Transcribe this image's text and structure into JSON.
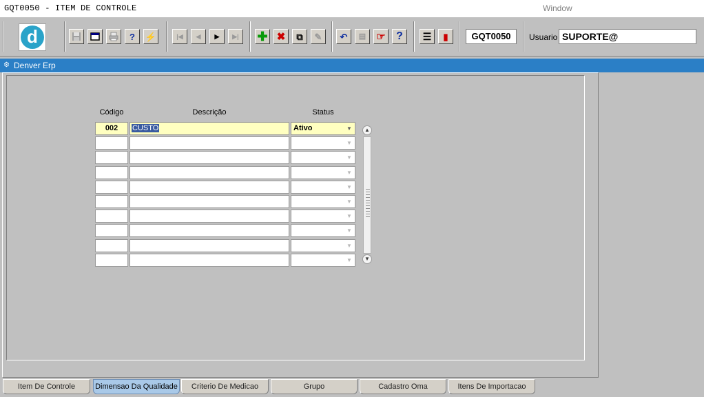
{
  "app": {
    "title": "GQT0050 - ITEM DE CONTROLE",
    "window_menu": "Window"
  },
  "toolbar": {
    "logo_letter": "d",
    "buttons": [
      {
        "icon": "save-icon"
      },
      {
        "icon": "window-icon"
      },
      {
        "icon": "print-icon"
      },
      {
        "icon": "query-icon"
      },
      {
        "icon": "execute-query-icon"
      },
      {
        "icon": "first-record-icon",
        "glyph": "|◀"
      },
      {
        "icon": "previous-record-icon",
        "glyph": "◀"
      },
      {
        "icon": "next-record-icon",
        "glyph": "▶"
      },
      {
        "icon": "last-record-icon",
        "glyph": "▶|"
      },
      {
        "icon": "insert-record-icon",
        "glyph": "✚"
      },
      {
        "icon": "delete-record-icon",
        "glyph": "✖"
      },
      {
        "icon": "duplicate-record-icon",
        "glyph": "⧉"
      },
      {
        "icon": "edit-icon",
        "glyph": "✎"
      },
      {
        "icon": "undo-icon",
        "glyph": "↶"
      },
      {
        "icon": "clipboard-icon",
        "glyph": "📋"
      },
      {
        "icon": "pointer-help-icon",
        "glyph": "☞"
      },
      {
        "icon": "help-icon",
        "glyph": "?"
      },
      {
        "icon": "menu-icon",
        "glyph": "☰"
      },
      {
        "icon": "exit-icon",
        "glyph": "⎋"
      }
    ],
    "form_code": "GQT0050",
    "user_label": "Usuario",
    "user_value": "SUPORTE@"
  },
  "window": {
    "title": "Denver Erp"
  },
  "grid": {
    "headers": {
      "code": "Código",
      "description": "Descrição",
      "status": "Status"
    },
    "rows": [
      {
        "code": "002",
        "description": "CUSTO",
        "status": "Ativo"
      },
      {
        "code": "",
        "description": "",
        "status": ""
      },
      {
        "code": "",
        "description": "",
        "status": ""
      },
      {
        "code": "",
        "description": "",
        "status": ""
      },
      {
        "code": "",
        "description": "",
        "status": ""
      },
      {
        "code": "",
        "description": "",
        "status": ""
      },
      {
        "code": "",
        "description": "",
        "status": ""
      },
      {
        "code": "",
        "description": "",
        "status": ""
      },
      {
        "code": "",
        "description": "",
        "status": ""
      },
      {
        "code": "",
        "description": "",
        "status": ""
      }
    ]
  },
  "tabs": [
    {
      "label": "Item De Controle",
      "active": false
    },
    {
      "label": "Dimensao Da Qualidade",
      "active": true
    },
    {
      "label": "Criterio De Medicao",
      "active": false
    },
    {
      "label": "Grupo",
      "active": false
    },
    {
      "label": "Cadastro Oma",
      "active": false
    },
    {
      "label": "Itens De Importacao",
      "active": false
    }
  ],
  "colors": {
    "window_bar": "#2b7fc6",
    "active_cell": "#ffffc0",
    "selection": "#3a5ba0",
    "active_tab": "#a9c9e8"
  }
}
